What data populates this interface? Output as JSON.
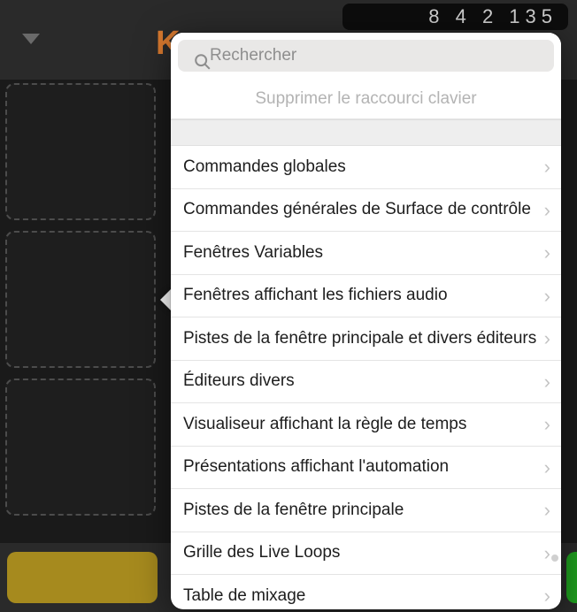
{
  "background": {
    "logo_text": "K",
    "counter": "8 4 2 135"
  },
  "popover": {
    "search_placeholder": "Rechercher",
    "delete_label": "Supprimer le raccourci clavier",
    "items": [
      {
        "label": "Commandes globales"
      },
      {
        "label": "Commandes générales de Surface de contrôle"
      },
      {
        "label": "Fenêtres Variables"
      },
      {
        "label": "Fenêtres affichant les fichiers audio"
      },
      {
        "label": "Pistes de la fenêtre principale et divers éditeurs"
      },
      {
        "label": "Éditeurs divers"
      },
      {
        "label": "Visualiseur affichant la règle de temps"
      },
      {
        "label": "Présentations affichant l'automation"
      },
      {
        "label": "Pistes de la fenêtre principale"
      },
      {
        "label": "Grille des Live Loops"
      },
      {
        "label": "Table de mixage"
      }
    ]
  }
}
